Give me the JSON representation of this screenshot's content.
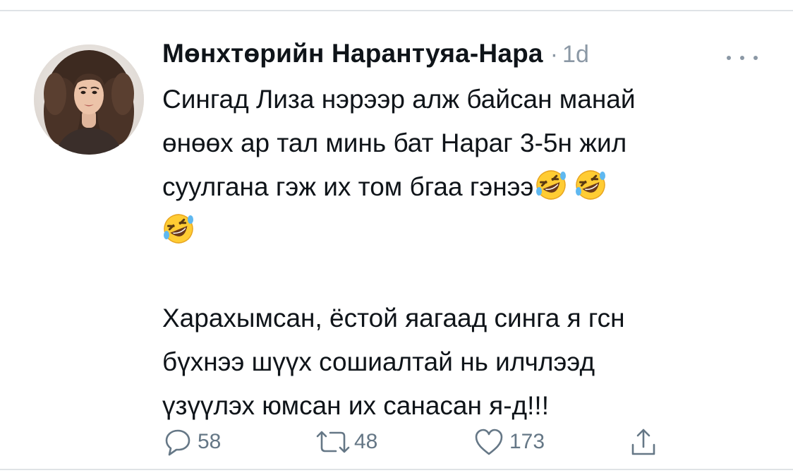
{
  "tweet": {
    "author_name": "Мөнхтөрийн Нарантуяа-Нара",
    "separator": "·",
    "timestamp": "1d",
    "paragraph_1": {
      "line_1": "Сингад Лиза нэрээр алж байсан манай",
      "line_2": "өнөөх ар тал минь бат Нараг 3-5н жил",
      "line_3": "суулгана гэж их том бгаа гэнээ"
    },
    "paragraph_2": {
      "line_1": "Харахымсан, ёстой яагаад синга я гсн",
      "line_2": "бүхнээ шүүх сошиалтай нь илчлээд",
      "line_3": "үзүүлэх юмсан их санасан я-д!!!"
    },
    "emoji": "rolling-on-the-floor-laughing",
    "actions": {
      "reply_count": "58",
      "retweet_count": "48",
      "like_count": "173"
    }
  },
  "colors": {
    "text": "#0f1419",
    "secondary": "#8b98a5",
    "icon": "#657786",
    "divider": "#dfe3e6"
  }
}
